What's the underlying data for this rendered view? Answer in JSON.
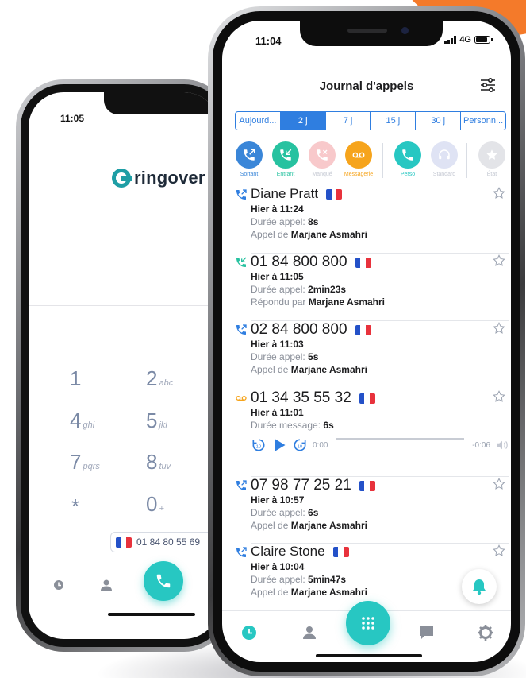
{
  "colors": {
    "brand_teal": "#27c7c2",
    "blue": "#2f7ee0",
    "voicemail_orange": "#f6a41c",
    "background_orange": "#f47a2a"
  },
  "back_phone": {
    "time": "11:05",
    "logo_text": "ringover",
    "keys": [
      {
        "digit": "1",
        "letters": ""
      },
      {
        "digit": "2",
        "letters": "abc"
      },
      {
        "digit": "4",
        "letters": "ghi"
      },
      {
        "digit": "5",
        "letters": "jkl"
      },
      {
        "digit": "7",
        "letters": "pqrs"
      },
      {
        "digit": "8",
        "letters": "tuv"
      },
      {
        "digit": "*",
        "letters": ""
      },
      {
        "digit": "0",
        "letters": "+"
      }
    ],
    "caller_number": "01 84 80 55 69",
    "nav_icons": [
      "clock-icon",
      "person-icon",
      "phone-icon",
      "chat-icon"
    ]
  },
  "front_phone": {
    "time": "11:04",
    "network": "4G",
    "battery_level": 0.85,
    "title": "Journal d'appels",
    "segments": [
      "Aujourd...",
      "2 j",
      "7 j",
      "15 j",
      "30 j",
      "Personn..."
    ],
    "active_segment": "2 j",
    "chips": [
      {
        "label": "Sortant",
        "color": "#3a86d8",
        "icon": "outgoing-call-icon",
        "dim": false
      },
      {
        "label": "Entrant",
        "color": "#27c2a0",
        "icon": "incoming-call-icon",
        "dim": false
      },
      {
        "label": "Manqué",
        "color": "#f8c9cb",
        "icon": "missed-call-icon",
        "dim": true
      },
      {
        "label": "Messagerie",
        "color": "#f6a41c",
        "icon": "voicemail-icon",
        "dim": false
      },
      {
        "label": "Perso",
        "color": "#27c7c2",
        "icon": "phone-icon",
        "dim": false
      },
      {
        "label": "Standard",
        "color": "#dfe3f4",
        "icon": "headset-icon",
        "dim": true
      },
      {
        "label": "État",
        "color": "#e3e4e8",
        "icon": "star-icon",
        "dim": true
      }
    ],
    "calls": [
      {
        "name": "Diane Pratt",
        "type": "outgoing",
        "when": "Hier à 11:24",
        "duration_label": "Durée appel: ",
        "duration": "8s",
        "by_label": "Appel de ",
        "by": "Marjane Asmahri"
      },
      {
        "name": "01 84 800 800",
        "type": "incoming",
        "when": "Hier à 11:05",
        "duration_label": "Durée appel: ",
        "duration": "2min23s",
        "by_label": "Répondu par  ",
        "by": "Marjane Asmahri"
      },
      {
        "name": "02 84 800 800",
        "type": "outgoing",
        "when": "Hier à 11:03",
        "duration_label": "Durée appel: ",
        "duration": "5s",
        "by_label": "Appel de ",
        "by": "Marjane Asmahri"
      },
      {
        "name": "01 34 35 55 32",
        "type": "voicemail",
        "when": "Hier à 11:01",
        "duration_label": "Durée message: ",
        "duration": "6s",
        "player_start": "0:00",
        "player_end": "-0:06"
      },
      {
        "name": "07 98 77 25 21",
        "type": "outgoing",
        "when": "Hier à 10:57",
        "duration_label": "Durée appel: ",
        "duration": "6s",
        "by_label": "Appel de ",
        "by": "Marjane Asmahri"
      },
      {
        "name": "Claire Stone",
        "type": "outgoing",
        "when": "Hier à 10:04",
        "duration_label": "Durée appel: ",
        "duration": "5min47s",
        "by_label": "Appel de ",
        "by": "Marjane Asmahri"
      }
    ],
    "nav_icons": [
      "clock-icon",
      "person-icon",
      "keypad-icon",
      "chat-icon",
      "gear-icon"
    ]
  }
}
